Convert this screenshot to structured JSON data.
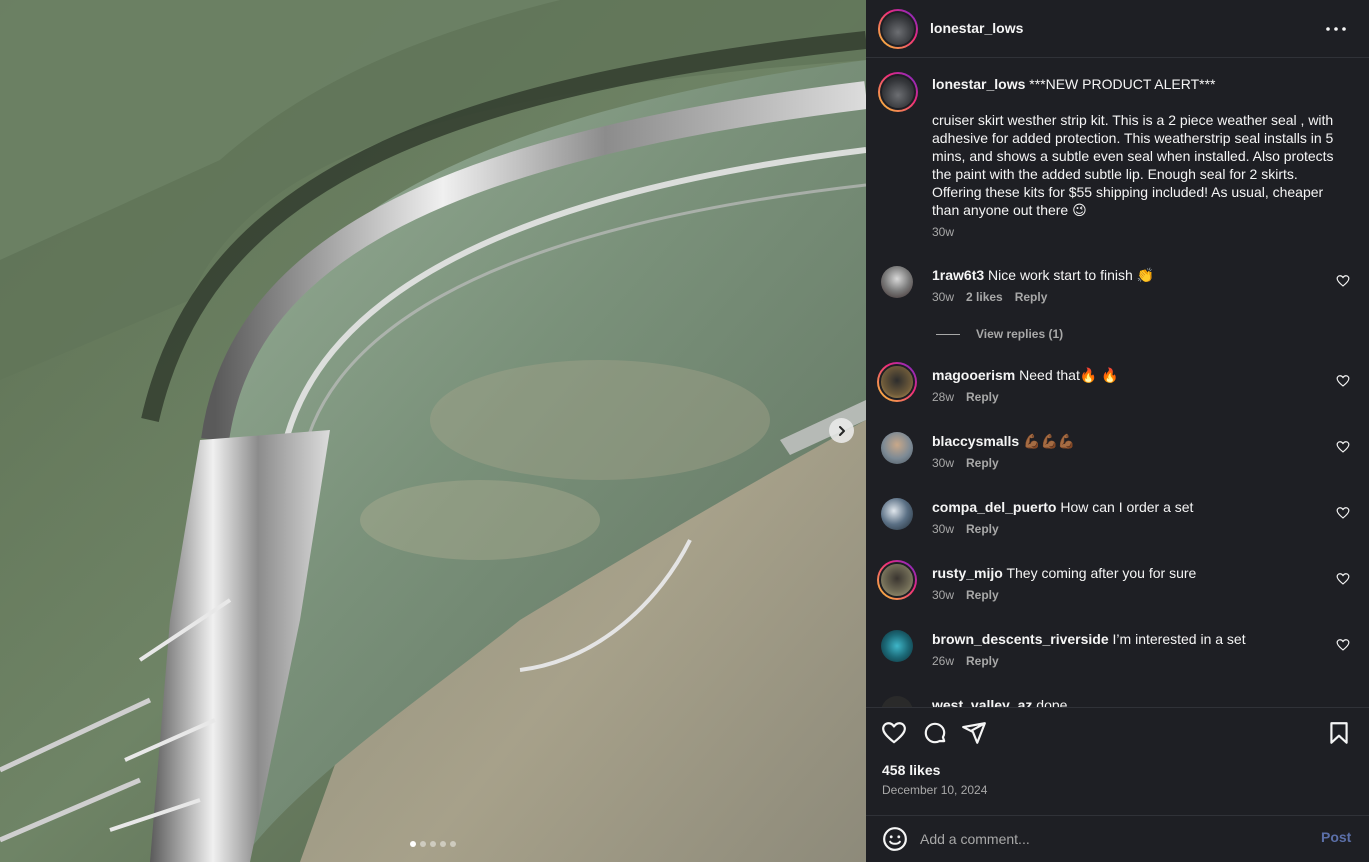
{
  "media": {
    "slide_count": 5,
    "active_slide": 1,
    "next_icon": "chevron-right-icon"
  },
  "header": {
    "username": "lonestar_lows",
    "more_icon": "more-horizontal-icon"
  },
  "caption": {
    "username": "lonestar_lows",
    "headline": "***NEW PRODUCT ALERT***",
    "body": "cruiser skirt westher strip kit. This is a 2 piece weather seal , with adhesive for added protection. This weatherstrip seal installs in 5 mins, and shows a subtle even seal when installed. Also protects the paint with the added subtle lip. Enough seal for 2 skirts. Offering these kits for $55 shipping included! As usual, cheaper than anyone out there 😉",
    "time": "30w"
  },
  "comments": [
    {
      "username": "1raw6t3",
      "text": "Nice work start to finish 👏",
      "time": "30w",
      "likes": "2 likes",
      "reply": "Reply"
    },
    {
      "username": "magooerism",
      "text": "Need that🔥 🔥",
      "time": "28w",
      "reply": "Reply"
    },
    {
      "username": "blaccysmalls",
      "text": "💪🏾💪🏾💪🏾",
      "time": "30w",
      "reply": "Reply"
    },
    {
      "username": "compa_del_puerto",
      "text": "How can I order a set",
      "time": "30w",
      "reply": "Reply"
    },
    {
      "username": "rusty_mijo",
      "text": "They coming after you for sure",
      "time": "30w",
      "reply": "Reply"
    },
    {
      "username": "brown_descents_riverside",
      "text": "I’m interested in a set",
      "time": "26w",
      "reply": "Reply"
    },
    {
      "username": "west_valley_az",
      "text": "dope"
    }
  ],
  "view_replies": "View replies (1)",
  "actions": {
    "like_icon": "heart-icon",
    "comment_icon": "comment-icon",
    "share_icon": "share-icon",
    "save_icon": "bookmark-icon"
  },
  "likes_label": "458 likes",
  "date": "December 10, 2024",
  "add_comment": {
    "placeholder": "Add a comment...",
    "post_label": "Post",
    "emoji_icon": "emoji-icon"
  },
  "colors": {
    "panel_bg": "#1e1f24",
    "muted_text": "#a8a8a8",
    "post_button": "#5b6fa8"
  }
}
